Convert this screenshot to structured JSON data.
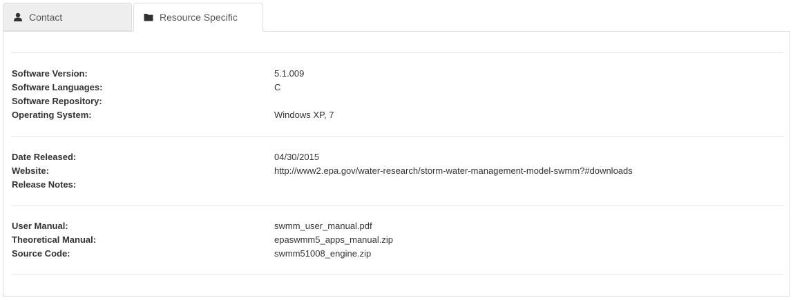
{
  "tabs": [
    {
      "label": "Contact",
      "icon": "user-icon",
      "active": false
    },
    {
      "label": "Resource Specific",
      "icon": "folder-icon",
      "active": true
    }
  ],
  "software": {
    "version_label": "Software Version:",
    "version_value": "5.1.009",
    "languages_label": "Software Languages:",
    "languages_value": "C",
    "repository_label": "Software Repository:",
    "repository_value": "",
    "os_label": "Operating System:",
    "os_value": "Windows XP, 7"
  },
  "release": {
    "date_label": "Date Released:",
    "date_value": "04/30/2015",
    "website_label": "Website:",
    "website_value": "http://www2.epa.gov/water-research/storm-water-management-model-swmm?#downloads",
    "notes_label": "Release Notes:",
    "notes_value": ""
  },
  "documents": {
    "user_manual_label": "User Manual:",
    "user_manual_value": "swmm_user_manual.pdf",
    "theoretical_manual_label": "Theoretical Manual:",
    "theoretical_manual_value": "epaswmm5_apps_manual.zip",
    "source_code_label": "Source Code:",
    "source_code_value": "swmm51008_engine.zip"
  }
}
